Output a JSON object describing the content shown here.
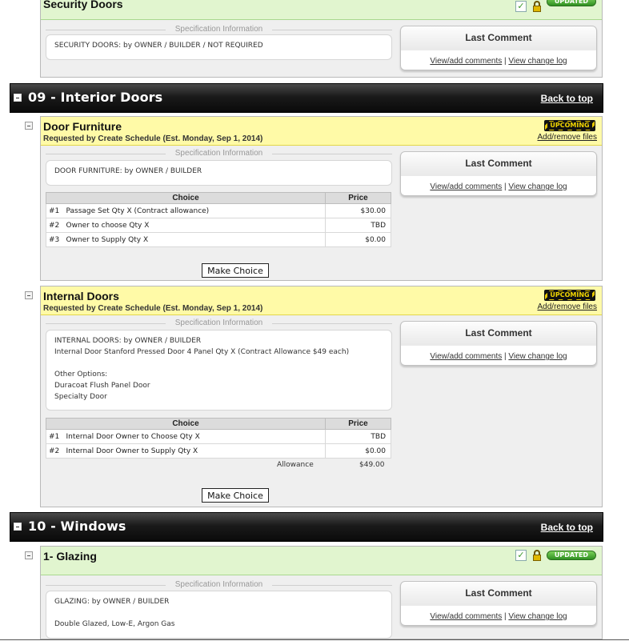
{
  "security_doors": {
    "title": "Security Doors",
    "badge": "UPDATED",
    "spec_label": "Specification Information",
    "spec_lines": [
      "SECURITY DOORS: by OWNER / BUILDER / NOT REQUIRED"
    ],
    "comment_title": "Last Comment",
    "view_comments": "View/add comments",
    "separator": "|",
    "view_log": "View change log"
  },
  "section_09": {
    "title": "09 - Interior Doors",
    "back_to_top": "Back to top"
  },
  "door_furniture": {
    "title": "Door Furniture",
    "requested": "Requested by Create Schedule (Est. Monday, Sep 1, 2014)",
    "badge": "UPCOMING",
    "add_remove": "Add/remove files",
    "spec_label": "Specification Information",
    "spec_lines": [
      "DOOR FURNITURE: by OWNER / BUILDER"
    ],
    "comment_title": "Last Comment",
    "view_comments": "View/add comments",
    "separator": "|",
    "view_log": "View change log",
    "table_headers": {
      "choice": "Choice",
      "price": "Price"
    },
    "rows": [
      {
        "num": "#1",
        "desc": "Passage Set Qty X (Contract allowance)",
        "price": "$30.00"
      },
      {
        "num": "#2",
        "desc": "Owner to choose Qty X",
        "price": "TBD"
      },
      {
        "num": "#3",
        "desc": "Owner to Supply Qty X",
        "price": "$0.00"
      }
    ],
    "make_choice": "Make Choice"
  },
  "internal_doors": {
    "title": "Internal Doors",
    "requested": "Requested by Create Schedule (Est. Monday, Sep 1, 2014)",
    "badge": "UPCOMING",
    "add_remove": "Add/remove files",
    "spec_label": "Specification Information",
    "spec_lines": [
      "INTERNAL DOORS: by OWNER / BUILDER",
      "Internal Door Stanford Pressed Door 4 Panel Qty X (Contract Allowance $49 each)",
      "",
      "Other Options:",
      "Duracoat Flush Panel Door",
      "Specialty Door"
    ],
    "comment_title": "Last Comment",
    "view_comments": "View/add comments",
    "separator": "|",
    "view_log": "View change log",
    "table_headers": {
      "choice": "Choice",
      "price": "Price"
    },
    "rows": [
      {
        "num": "#1",
        "desc": "Internal Door Owner to Choose Qty X",
        "price": "TBD"
      },
      {
        "num": "#2",
        "desc": "Internal Door Owner to Supply Qty X",
        "price": "$0.00"
      }
    ],
    "allowance_label": "Allowance",
    "allowance_value": "$49.00",
    "make_choice": "Make Choice"
  },
  "section_10": {
    "title": "10 - Windows",
    "back_to_top": "Back to top"
  },
  "glazing": {
    "title": "1- Glazing",
    "badge": "UPDATED",
    "spec_label": "Specification Information",
    "spec_lines": [
      "GLAZING: by OWNER / BUILDER",
      "",
      "Double Glazed, Low-E, Argon Gas"
    ],
    "comment_title": "Last Comment",
    "view_comments": "View/add comments",
    "separator": "|",
    "view_log": "View change log"
  },
  "colors": {
    "upcoming_bg": "#fffaa7",
    "updated_bg": "#e1f5cf",
    "section_bar": "#111111"
  }
}
